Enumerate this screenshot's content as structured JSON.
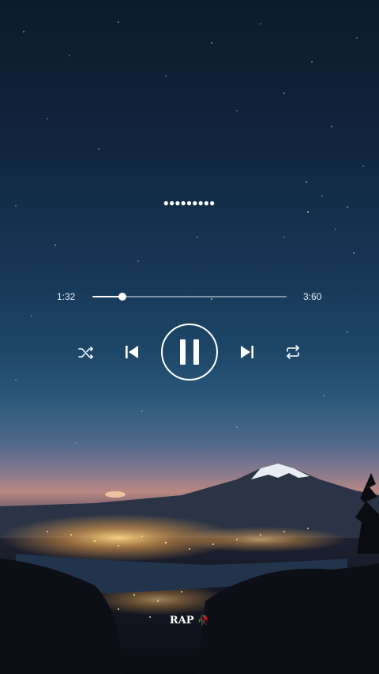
{
  "player": {
    "title": "•••••••••",
    "elapsed": "1:32",
    "duration": "3:60",
    "progress_fraction": 0.155
  },
  "controls": {
    "shuffle_icon": "shuffle-icon",
    "previous_icon": "skip-previous-icon",
    "play_pause_icon": "pause-icon",
    "next_icon": "skip-next-icon",
    "repeat_icon": "repeat-icon"
  },
  "caption": {
    "text": "RAP",
    "emoji": "🥀"
  },
  "colors": {
    "controls": "#ffffff",
    "accent_rose": "#ff4a4a"
  }
}
